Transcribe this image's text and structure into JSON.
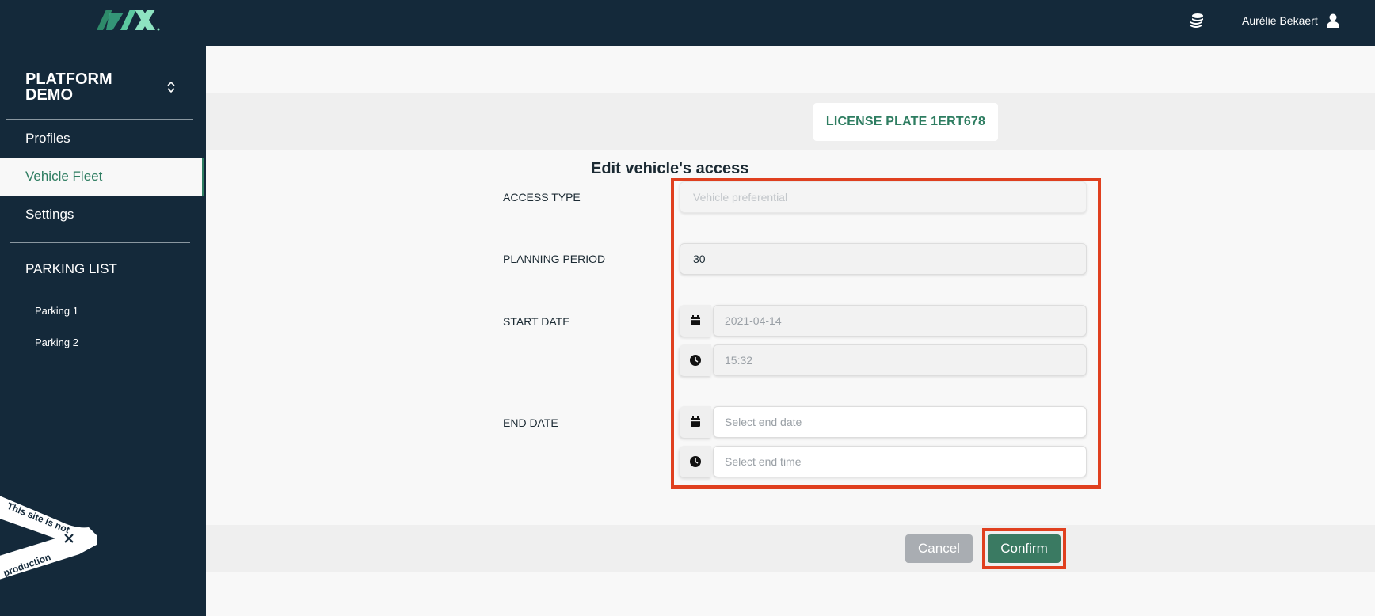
{
  "topbar": {
    "logo_text": "IZIX",
    "user_name": "Aurélie Bekaert",
    "coins_icon": "coins-stack-icon",
    "user_icon": "user-icon"
  },
  "sidebar": {
    "organization": "PLATFORM DEMO",
    "nav": [
      {
        "label": "Profiles"
      },
      {
        "label": "Vehicle Fleet",
        "active": true
      },
      {
        "label": "Settings"
      }
    ],
    "parking_section": "PARKING LIST",
    "parkings": [
      "Parking 1",
      "Parking 2"
    ],
    "ribbon": {
      "line1": "This site is not",
      "line2": "production"
    }
  },
  "page": {
    "title": "Edit vehicle's access",
    "plate_label": "LICENSE PLATE 1ERT678"
  },
  "form": {
    "access_type": {
      "label": "ACCESS TYPE",
      "placeholder": "Vehicle preferential"
    },
    "planning_period": {
      "label": "PLANNING PERIOD",
      "value": "30"
    },
    "start_date": {
      "label": "START DATE",
      "date": "2021-04-14",
      "time": "15:32"
    },
    "end_date": {
      "label": "END DATE",
      "date_placeholder": "Select end date",
      "time_placeholder": "Select end time"
    }
  },
  "actions": {
    "cancel": "Cancel",
    "confirm": "Confirm"
  },
  "colors": {
    "navy": "#14293a",
    "accent_green": "#2e7d61",
    "highlight_red": "#e0401f"
  }
}
